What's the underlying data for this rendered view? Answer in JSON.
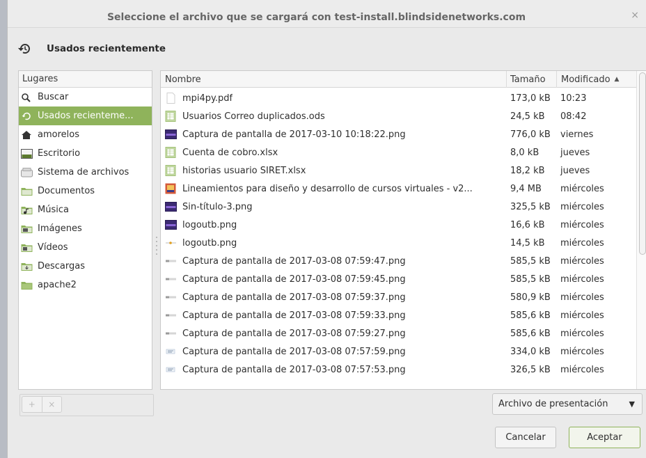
{
  "dialog": {
    "title": "Seleccione el archivo que se cargará con test-install.blindsidenetworks.com",
    "close_glyph": "×"
  },
  "location": {
    "label": "Usados recientemente",
    "icon": "history-icon"
  },
  "places": {
    "header": "Lugares",
    "items": [
      {
        "label": "Buscar",
        "icon": "search-icon"
      },
      {
        "label": "Usados recienteme...",
        "icon": "history-icon",
        "selected": true
      },
      {
        "label": "amorelos",
        "icon": "home-icon"
      },
      {
        "label": "Escritorio",
        "icon": "desktop-icon"
      },
      {
        "label": "Sistema de archivos",
        "icon": "drive-icon"
      },
      {
        "label": "Documentos",
        "icon": "folder-documents-icon"
      },
      {
        "label": "Música",
        "icon": "folder-music-icon"
      },
      {
        "label": "Imágenes",
        "icon": "folder-pictures-icon"
      },
      {
        "label": "Vídeos",
        "icon": "folder-videos-icon"
      },
      {
        "label": "Descargas",
        "icon": "folder-downloads-icon"
      },
      {
        "label": "apache2",
        "icon": "folder-icon"
      }
    ],
    "add_glyph": "+",
    "remove_glyph": "×"
  },
  "files": {
    "columns": {
      "name": "Nombre",
      "size": "Tamaño",
      "modified": "Modificado"
    },
    "sort_glyph": "▲",
    "rows": [
      {
        "name": "mpi4py.pdf",
        "size": "173,0 kB",
        "modified": "10:23",
        "icon": "pdf-file-icon"
      },
      {
        "name": "Usuarios Correo duplicados.ods",
        "size": "24,5 kB",
        "modified": "08:42",
        "icon": "spreadsheet-file-icon"
      },
      {
        "name": "Captura de pantalla de 2017-03-10 10:18:22.png",
        "size": "776,0 kB",
        "modified": "viernes",
        "icon": "image-file-icon"
      },
      {
        "name": "Cuenta de cobro.xlsx",
        "size": "8,0 kB",
        "modified": "jueves",
        "icon": "spreadsheet-file-icon"
      },
      {
        "name": "historias usuario SIRET.xlsx",
        "size": "18,2 kB",
        "modified": "jueves",
        "icon": "spreadsheet-file-icon"
      },
      {
        "name": "Lineamientos para diseño y desarrollo de cursos virtuales  - v2...",
        "size": "9,4 MB",
        "modified": "miércoles",
        "icon": "presentation-file-icon"
      },
      {
        "name": "Sin-título-3.png",
        "size": "325,5 kB",
        "modified": "miércoles",
        "icon": "image-file-icon"
      },
      {
        "name": "logoutb.png",
        "size": "16,6 kB",
        "modified": "miércoles",
        "icon": "image-file-icon"
      },
      {
        "name": "logoutb.png",
        "size": "14,5 kB",
        "modified": "miércoles",
        "icon": "image-thumb-logo-icon"
      },
      {
        "name": "Captura de pantalla de 2017-03-08 07:59:47.png",
        "size": "585,5 kB",
        "modified": "miércoles",
        "icon": "image-thumb-icon"
      },
      {
        "name": "Captura de pantalla de 2017-03-08 07:59:45.png",
        "size": "585,5 kB",
        "modified": "miércoles",
        "icon": "image-thumb-icon"
      },
      {
        "name": "Captura de pantalla de 2017-03-08 07:59:37.png",
        "size": "580,9 kB",
        "modified": "miércoles",
        "icon": "image-thumb-icon"
      },
      {
        "name": "Captura de pantalla de 2017-03-08 07:59:33.png",
        "size": "585,6 kB",
        "modified": "miércoles",
        "icon": "image-thumb-icon"
      },
      {
        "name": "Captura de pantalla de 2017-03-08 07:59:27.png",
        "size": "585,6 kB",
        "modified": "miércoles",
        "icon": "image-thumb-icon"
      },
      {
        "name": "Captura de pantalla de 2017-03-08 07:57:59.png",
        "size": "334,0 kB",
        "modified": "miércoles",
        "icon": "image-thumb-text-icon"
      },
      {
        "name": "Captura de pantalla de 2017-03-08 07:57:53.png",
        "size": "326,5 kB",
        "modified": "miércoles",
        "icon": "image-thumb-text-icon"
      }
    ]
  },
  "filter": {
    "selected": "Archivo de presentación",
    "caret": "▼"
  },
  "buttons": {
    "cancel": "Cancelar",
    "accept": "Aceptar"
  },
  "colors": {
    "accent": "#8fb35b",
    "background": "#eaeaea"
  }
}
